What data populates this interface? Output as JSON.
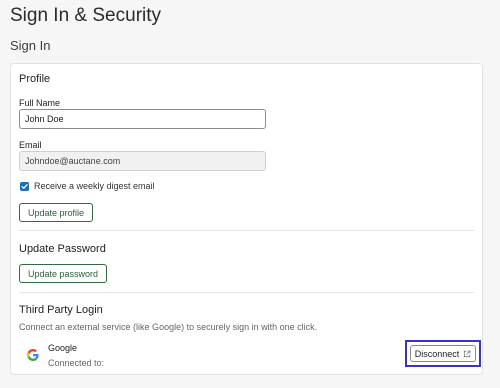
{
  "page": {
    "title": "Sign In & Security",
    "section_title": "Sign In"
  },
  "profile": {
    "heading": "Profile",
    "full_name_label": "Full Name",
    "full_name_value": "John Doe",
    "email_label": "Email",
    "email_value": "Johndoe@auctane.com",
    "digest_checkbox_label": "Receive a weekly digest email",
    "digest_checked": true,
    "update_button": "Update profile"
  },
  "password": {
    "heading": "Update Password",
    "update_button": "Update password"
  },
  "third_party": {
    "heading": "Third Party Login",
    "description": "Connect an external service (like Google) to securely sign in with one click.",
    "service_name": "Google",
    "status_text": "Connected to:",
    "disconnect_button": "Disconnect",
    "logo_icon": "google-logo",
    "action_icon": "external-link-icon"
  },
  "colors": {
    "accent_green": "#2f6b3f",
    "checkbox_blue": "#1c6fbf",
    "highlight_outline": "#3b2fd6"
  }
}
